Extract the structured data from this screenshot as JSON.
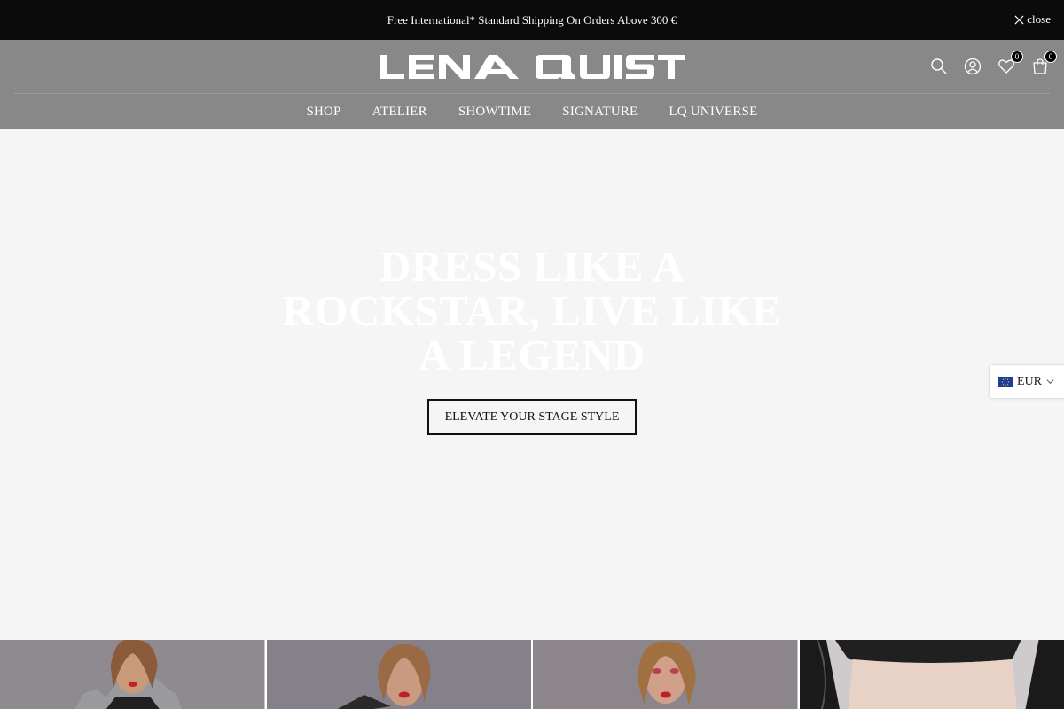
{
  "announcement": {
    "text": "Free International* Standard Shipping On Orders Above 300 €",
    "close_label": "close"
  },
  "header": {
    "logo_text": "LENA QUIST",
    "wishlist_count": "0",
    "cart_count": "0",
    "bg_color": "#888888"
  },
  "nav": {
    "items": [
      {
        "label": "SHOP"
      },
      {
        "label": "ATELIER"
      },
      {
        "label": "SHOWTIME"
      },
      {
        "label": "SIGNATURE"
      },
      {
        "label": "LQ UNIVERSE"
      }
    ]
  },
  "hero": {
    "headline_line1": "DRESS LIKE A",
    "headline_line2": "ROCKSTAR, LIVE LIKE",
    "headline_line3": "A LEGEND",
    "cta_label": "ELEVATE YOUR STAGE STYLE"
  },
  "currency": {
    "selected": "EUR",
    "flag_icon": "eu-flag-icon"
  },
  "icons": [
    "close-icon",
    "search-icon",
    "account-icon",
    "wishlist-heart-icon",
    "cart-bag-icon",
    "chevron-down-icon"
  ]
}
